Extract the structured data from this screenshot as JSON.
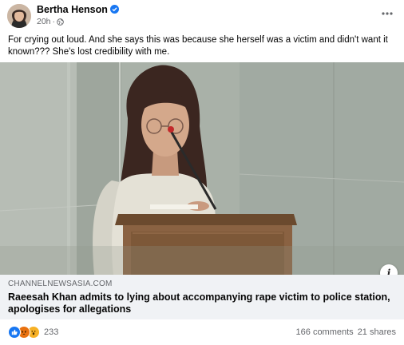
{
  "post": {
    "author": "Bertha Henson",
    "time": "20h",
    "separator": "·",
    "audience_icon": "globe-icon",
    "text": "For crying out loud. And she says this was because she herself was a victim and didn't want it known??? She's lost credibility with me."
  },
  "link": {
    "domain": "CHANNELNEWSASIA.COM",
    "title": "Raeesah Khan admits to lying about accompanying rape victim to police station, apologises for allegations"
  },
  "footer": {
    "reaction_icons": [
      "like-icon",
      "angry-icon",
      "wow-icon"
    ],
    "reaction_count": "233",
    "comments": "166 comments",
    "shares": "21 shares"
  },
  "colors": {
    "brand_blue": "#1877f2",
    "link_bg": "#f0f2f5",
    "secondary_text": "#65676b"
  }
}
